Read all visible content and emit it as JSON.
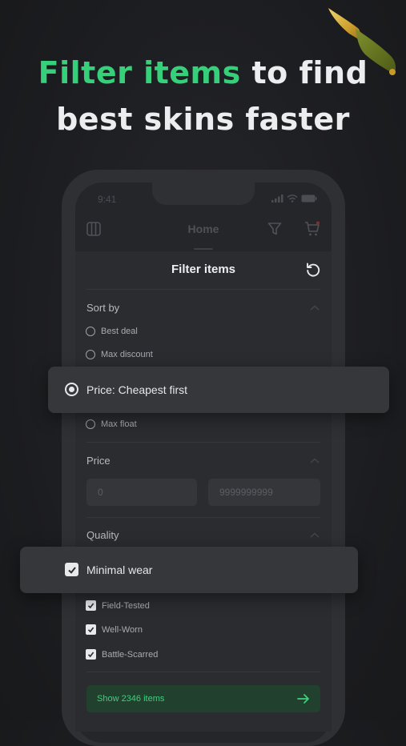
{
  "headline": {
    "line1_accent": "Filter items",
    "line1_rest": " to find",
    "line2": "best skins faster"
  },
  "colors": {
    "accent": "#36d07a",
    "background": "#1b1c1f",
    "card": "#35373b"
  },
  "status_bar": {
    "time": "9:41"
  },
  "app_bar": {
    "title": "Home",
    "icons": [
      "menu-icon",
      "filter-icon",
      "cart-icon"
    ]
  },
  "filter": {
    "title": "Filter items",
    "sort": {
      "label": "Sort by",
      "options": [
        "Best deal",
        "Max discount",
        "Price: Cheapest first",
        "Max float"
      ],
      "selected": "Price: Cheapest first"
    },
    "price": {
      "label": "Price",
      "min_placeholder": "0",
      "max_placeholder": "9999999999"
    },
    "quality": {
      "label": "Quality",
      "options": [
        "Minimal wear",
        "Field-Tested",
        "Well-Worn",
        "Battle-Scarred"
      ],
      "checked": [
        "Minimal wear",
        "Field-Tested",
        "Well-Worn",
        "Battle-Scarred"
      ]
    },
    "show_button": "Show 2346 items"
  }
}
